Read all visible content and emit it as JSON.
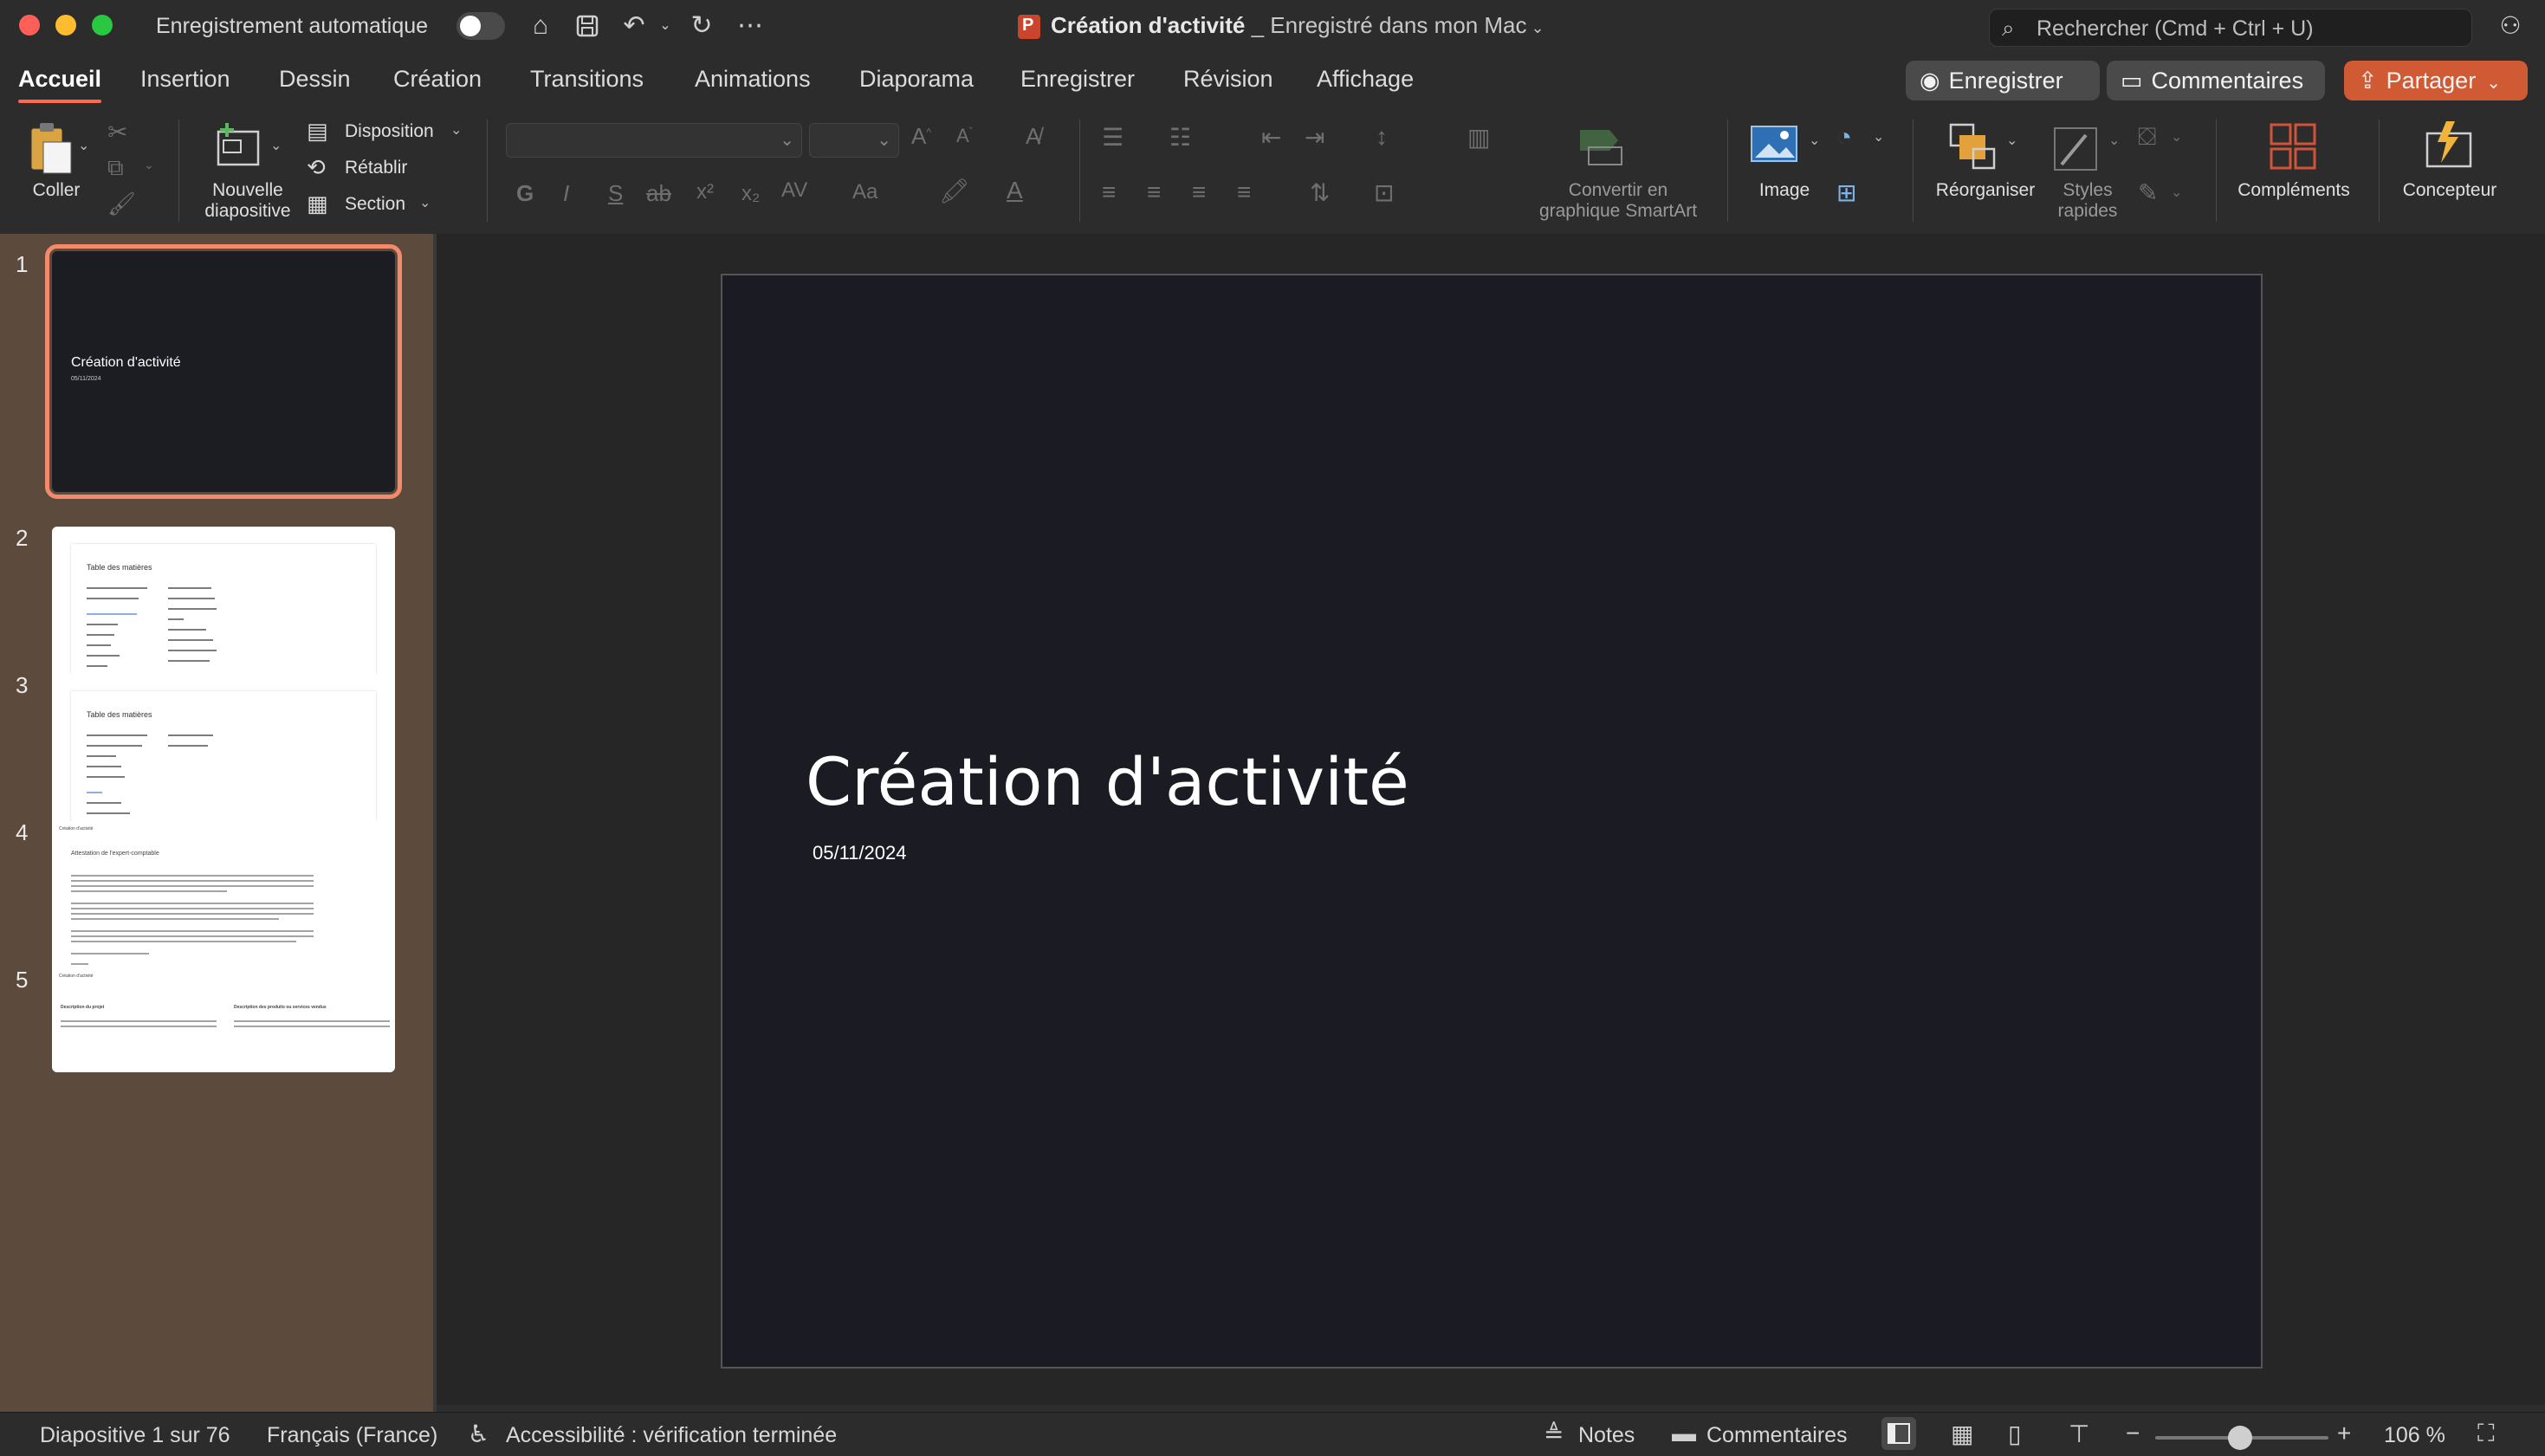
{
  "window": {
    "autosave_label": "Enregistrement automatique",
    "doc_title": "Création d'activité",
    "doc_subtitle": " _ Enregistré dans mon Mac",
    "search_placeholder": "Rechercher (Cmd + Ctrl + U)"
  },
  "tabs": [
    {
      "label": "Accueil",
      "active": true
    },
    {
      "label": "Insertion"
    },
    {
      "label": "Dessin"
    },
    {
      "label": "Création"
    },
    {
      "label": "Transitions"
    },
    {
      "label": "Animations"
    },
    {
      "label": "Diaporama"
    },
    {
      "label": "Enregistrer"
    },
    {
      "label": "Révision"
    },
    {
      "label": "Affichage"
    }
  ],
  "actions": {
    "record": "Enregistrer",
    "comments": "Commentaires",
    "share": "Partager"
  },
  "ribbon": {
    "paste": "Coller",
    "new_slide_1": "Nouvelle",
    "new_slide_2": "diapositive",
    "layout": "Disposition",
    "reset": "Rétablir",
    "section": "Section",
    "smartart_1": "Convertir en",
    "smartart_2": "graphique SmartArt",
    "image": "Image",
    "arrange": "Réorganiser",
    "quick_styles_1": "Styles",
    "quick_styles_2": "rapides",
    "addins": "Compléments",
    "designer": "Concepteur",
    "bold": "G",
    "italic": "I",
    "underline": "S",
    "strike": "ab",
    "superscript": "x²",
    "subscript": "x₂",
    "char_spacing": "AV",
    "change_case": "Aa"
  },
  "thumbnails": [
    {
      "number": "1",
      "title": "Création d'activité",
      "date": "05/11/2024"
    },
    {
      "number": "2",
      "heading": "Table des matières"
    },
    {
      "number": "3",
      "heading": "Table des matières"
    },
    {
      "number": "4",
      "header": "Création d'activité",
      "heading": "Attestation de l'expert-comptable"
    },
    {
      "number": "5",
      "header": "Création d'activité",
      "col1": "Description du projet",
      "col2": "Description des produits ou services vendus"
    }
  ],
  "slide": {
    "title": "Création d'activité",
    "date": "05/11/2024"
  },
  "status": {
    "slide_pos": "Diapositive 1 sur 76",
    "language": "Français (France)",
    "accessibility": "Accessibilité : vérification terminée",
    "notes": "Notes",
    "comments": "Commentaires",
    "zoom": "106 %",
    "zoom_level_pct": 106
  },
  "colors": {
    "accent": "#ff6a4d",
    "share": "#d05a33",
    "slide_bg": "#1b1b24",
    "thumb_pane": "#5c4a3d"
  }
}
